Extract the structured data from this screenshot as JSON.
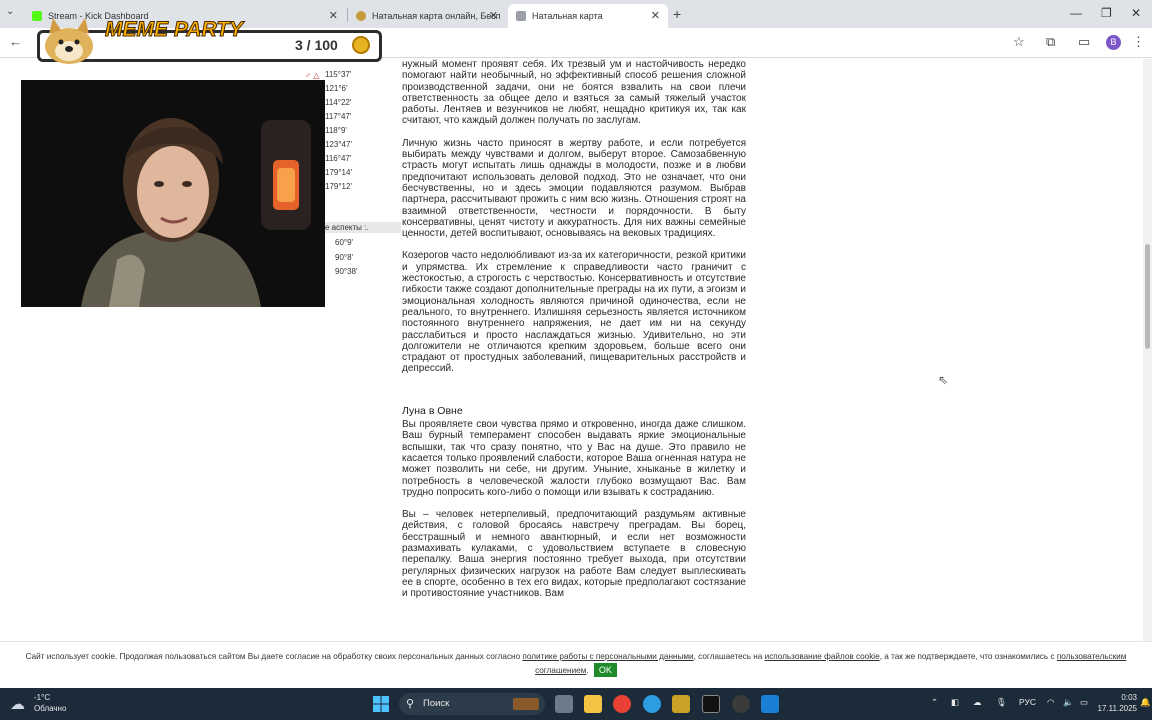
{
  "browser": {
    "tabs": [
      {
        "title": "Stream - Kick Dashboard",
        "color": "#53fc18"
      },
      {
        "title": "Натальная карта онлайн, Бесп",
        "color": "#c89a3a"
      },
      {
        "title": "Натальная карта",
        "color": "#9aa0a6",
        "active": true
      }
    ],
    "new_tab": "+",
    "menu": "⌄",
    "profile_letter": "B"
  },
  "overlay": {
    "title": "MEME PARTY",
    "count": "3 / 100"
  },
  "left_column": {
    "degrees": [
      "115°37'",
      "121°6'",
      "114°22'",
      "117°47'",
      "118°9'",
      "123°47'",
      "116°47'",
      "179°14'",
      "179°12'"
    ],
    "aspects_label": "е аспекты :.",
    "aspects": [
      "60°9'",
      "90°8'",
      "90°38'"
    ]
  },
  "article": {
    "p1": "нужный момент проявят себя. Их трезвый ум и настойчивость нередко помогают найти необычный, но эффективный способ решения сложной производственной задачи, они не боятся взвалить на свои плечи ответственность за общее дело и взяться за самый тяжелый участок работы. Лентяев и везунчиков не любят, нещадно критикуя их, так как считают, что каждый должен получать по заслугам.",
    "p2": "Личную жизнь часто приносят в жертву работе, и если потребуется выбирать между чувствами и долгом, выберут второе. Самозабвенную страсть могут испытать лишь однажды в молодости, позже и в любви предпочитают использовать деловой подход. Это не означает, что они бесчувственны, но и здесь эмоции подавляются разумом. Выбрав партнера, рассчитывают прожить с ним всю жизнь. Отношения строят на взаимной ответственности, честности и порядочности. В быту консервативны, ценят чистоту и аккуратность. Для них важны семейные ценности, детей воспитывают, основываясь на вековых традициях.",
    "p3": "Козерогов часто недолюбливают из-за их категоричности, резкой критики и упрямства. Их стремление к справедливости часто граничит с жестокостью, а строгость с черствостью. Консервативность и отсутствие гибкости также создают дополнительные преграды на их пути, а эгоизм и эмоциональная холодность являются причиной одиночества, если не реального, то внутреннего. Излишняя серьезность является источником постоянного внутреннего напряжения, не дает им ни на секунду расслабиться и просто наслаждаться жизнью. Удивительно, но эти долгожители не отличаются крепким здоровьем, больше всего они страдают от простудных заболеваний, пищеварительных расстройств и депрессий.",
    "heading": "Луна в Овне",
    "p4": "Вы проявляете свои чувства прямо и откровенно, иногда даже слишком. Ваш бурный темперамент способен выдавать яркие эмоциональные вспышки, так что сразу понятно, что у Вас на душе. Это правило не касается только проявлений слабости, которое Ваша огненная натура не может позволить ни себе, ни другим. Уныние, хныканье в жилетку и потребность в человеческой жалости глубоко возмущают Вас. Вам трудно попросить кого-либо о помощи или взывать к состраданию.",
    "p5": "Вы – человек нетерпеливый, предпочитающий раздумьям активные действия, с головой бросаясь навстречу преградам. Вы борец, бесстрашный и немного авантюрный, и если нет возможности размахивать кулаками, с удовольствием вступаете в словесную перепалку. Ваша энергия постоянно требует выхода, при отсутствии регулярных физических нагрузок на работе Вам следует выплескивать ее в спорте, особенно в тех его видах, которые предполагают состязание и противостояние участников. Вам"
  },
  "cookie": {
    "text1": "Сайт использует cookie. Продолжая пользоваться сайтом Вы даете согласие на обработку своих персональных данных согласно ",
    "link1": "политике работы с персональными данными",
    "text2": ", соглашаетесь на ",
    "link2": "использование файлов cookie",
    "text3": ", а так же подтверждаете, что ознакомились с ",
    "link3": "пользовательским соглашением",
    "text4": ".",
    "ok": "OK"
  },
  "taskbar": {
    "temp": "-1°C",
    "weather": "Облачно",
    "search": "Поиск",
    "lang": "РУС",
    "time": "0:03",
    "date": "17.11.2025"
  }
}
